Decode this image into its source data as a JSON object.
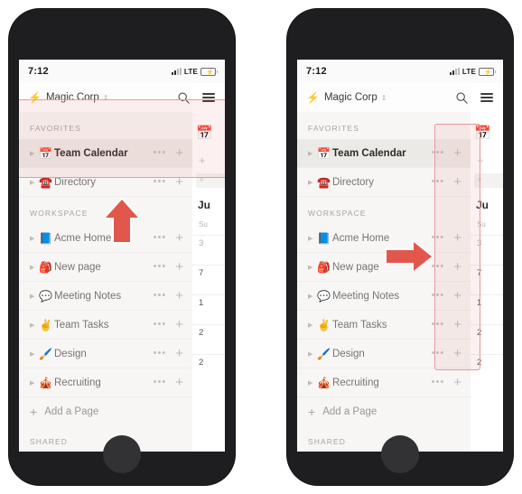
{
  "meta": {
    "accent_red": "#e2574c",
    "highlight_border": "#e79a99",
    "highlight_fill": "rgba(231,118,115,0.11)",
    "phone_body": "#1e1e20",
    "sidebar_bg": "#f7f6f5"
  },
  "status_bar": {
    "time": "7:12",
    "network": "LTE",
    "signal_icon": "signal-bars-icon",
    "battery_icon": "battery-charging-icon"
  },
  "app_bar": {
    "workspace_emoji": "⚡",
    "workspace_name": "Magic Corp",
    "switcher_caret": "⌃⌄",
    "search_icon": "search-icon",
    "compose_icon": "compose-icon",
    "menu_icon": "hamburger-menu-icon"
  },
  "sidebar": {
    "sections": [
      {
        "label": "FAVORITES",
        "items": [
          {
            "emoji": "📅",
            "label": "Team Calendar",
            "active": true,
            "more": "•••",
            "add": "+"
          },
          {
            "emoji": "☎️",
            "label": "Directory",
            "active": false,
            "more": "•••",
            "add": "+"
          }
        ]
      },
      {
        "label": "WORKSPACE",
        "items": [
          {
            "emoji": "📘",
            "label": "Acme Home",
            "active": false,
            "more": "•••",
            "add": "+"
          },
          {
            "emoji": "🎒",
            "label": "New page",
            "active": false,
            "more": "•••",
            "add": "+"
          },
          {
            "emoji": "💬",
            "label": "Meeting Notes",
            "active": false,
            "more": "•••",
            "add": "+"
          },
          {
            "emoji": "✌️",
            "label": "Team Tasks",
            "active": false,
            "more": "•••",
            "add": "+"
          },
          {
            "emoji": "🖌️",
            "label": "Design",
            "active": false,
            "more": "•••",
            "add": "+"
          },
          {
            "emoji": "🎪",
            "label": "Recruiting",
            "active": false,
            "more": "•••",
            "add": "+"
          }
        ]
      }
    ],
    "add_page": {
      "plus": "+",
      "label": "Add a Page"
    },
    "shared_label": "SHARED",
    "disclosure_triangle": "▶"
  },
  "peek_panel": {
    "page_emoji": "📅",
    "add_block": "+",
    "search_glyph": "⌕",
    "month": "Ju",
    "weekday": "Su",
    "day_cells": [
      "3",
      "7",
      "1",
      "2",
      "2"
    ]
  },
  "annotations": {
    "left_phone": {
      "highlight_name": "favorites-section-highlight",
      "arrow": "up-arrow",
      "arrow_direction": "up"
    },
    "right_phone": {
      "highlight_name": "row-actions-column-highlight",
      "arrow": "right-arrow",
      "arrow_direction": "right"
    }
  }
}
